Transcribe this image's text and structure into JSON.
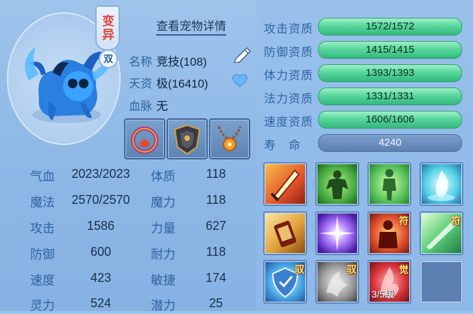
{
  "pet": {
    "variant_tag": "变异",
    "variant_sub": "双",
    "detail_link": "查看宠物详情",
    "name_label": "名称",
    "name_value": "竞技(108)",
    "talent_label": "天资",
    "talent_value": "极(16410)",
    "bloodline_label": "血脉",
    "bloodline_value": "无"
  },
  "attributes": [
    {
      "label": "气血",
      "value": "2023/2023",
      "label2": "体质",
      "value2": "118"
    },
    {
      "label": "魔法",
      "value": "2570/2570",
      "label2": "魔力",
      "value2": "118"
    },
    {
      "label": "攻击",
      "value": "1586",
      "label2": "力量",
      "value2": "627"
    },
    {
      "label": "防御",
      "value": "600",
      "label2": "耐力",
      "value2": "118"
    },
    {
      "label": "速度",
      "value": "423",
      "label2": "敏捷",
      "value2": "174"
    },
    {
      "label": "灵力",
      "value": "524",
      "label2": "潜力",
      "value2": "25"
    }
  ],
  "aptitudes": [
    {
      "label": "攻击资质",
      "value": "1572/1572"
    },
    {
      "label": "防御资质",
      "value": "1415/1415"
    },
    {
      "label": "体力资质",
      "value": "1393/1393"
    },
    {
      "label": "法力资质",
      "value": "1331/1331"
    },
    {
      "label": "速度资质",
      "value": "1606/1606"
    }
  ],
  "lifespan": {
    "label": "寿　命",
    "value": "4240"
  },
  "skill_tags": {
    "fu": "符",
    "yu": "驭",
    "jue": "觉"
  },
  "awaken_level": "3/5级",
  "colors": {
    "bar_green": "#57d69d",
    "label_blue": "#2f64a3",
    "panel_blue": "#5d80b2"
  },
  "equipment_icons": [
    "ring-equipment-icon",
    "armor-equipment-icon",
    "necklace-equipment-icon"
  ],
  "skill_icons": [
    "sword-strike-skill-icon",
    "muscle-power-skill-icon",
    "green-figure-skill-icon",
    "blue-flame-skill-icon",
    "scroll-skill-icon",
    "purple-burst-skill-icon",
    "fire-figure-skill-icon",
    "green-slash-skill-icon",
    "shield-skill-icon",
    "gray-impact-skill-icon",
    "red-awaken-skill-icon",
    "empty-slot"
  ]
}
